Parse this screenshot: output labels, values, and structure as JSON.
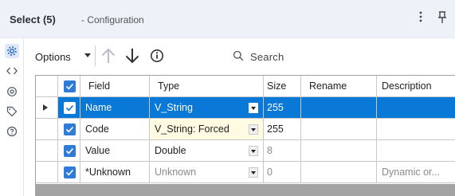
{
  "window": {
    "title": "Select",
    "count": "(5)",
    "subtitle": "- Configuration",
    "more_icon": "more-vertical-icon",
    "pin_icon": "pin-icon"
  },
  "sidebar": {
    "items": [
      {
        "icon": "gear-icon",
        "active": true
      },
      {
        "icon": "code-icon",
        "active": false
      },
      {
        "icon": "target-icon",
        "active": false
      },
      {
        "icon": "tag-icon",
        "active": false
      },
      {
        "icon": "help-icon",
        "active": false
      }
    ]
  },
  "toolbar": {
    "options_label": "Options",
    "search_placeholder": "Search"
  },
  "grid": {
    "headers": {
      "field": "Field",
      "type": "Type",
      "size": "Size",
      "rename": "Rename",
      "description": "Description"
    },
    "rows": [
      {
        "field": "Name",
        "type": "V_String",
        "size": "255",
        "rename": "",
        "description": ""
      },
      {
        "field": "Code",
        "type": "V_String: Forced",
        "size": "255",
        "rename": "",
        "description": ""
      },
      {
        "field": "Value",
        "type": "Double",
        "size": "8",
        "rename": "",
        "description": ""
      },
      {
        "field": "*Unknown",
        "type": "Unknown",
        "size": "0",
        "rename": "",
        "description": "Dynamic or..."
      }
    ]
  },
  "colors": {
    "selection": "#0a78d7",
    "checkbox": "#2f7bd8",
    "forced_type_bg": "#fffbe3",
    "title_bar_bg": "#eef1f8"
  }
}
